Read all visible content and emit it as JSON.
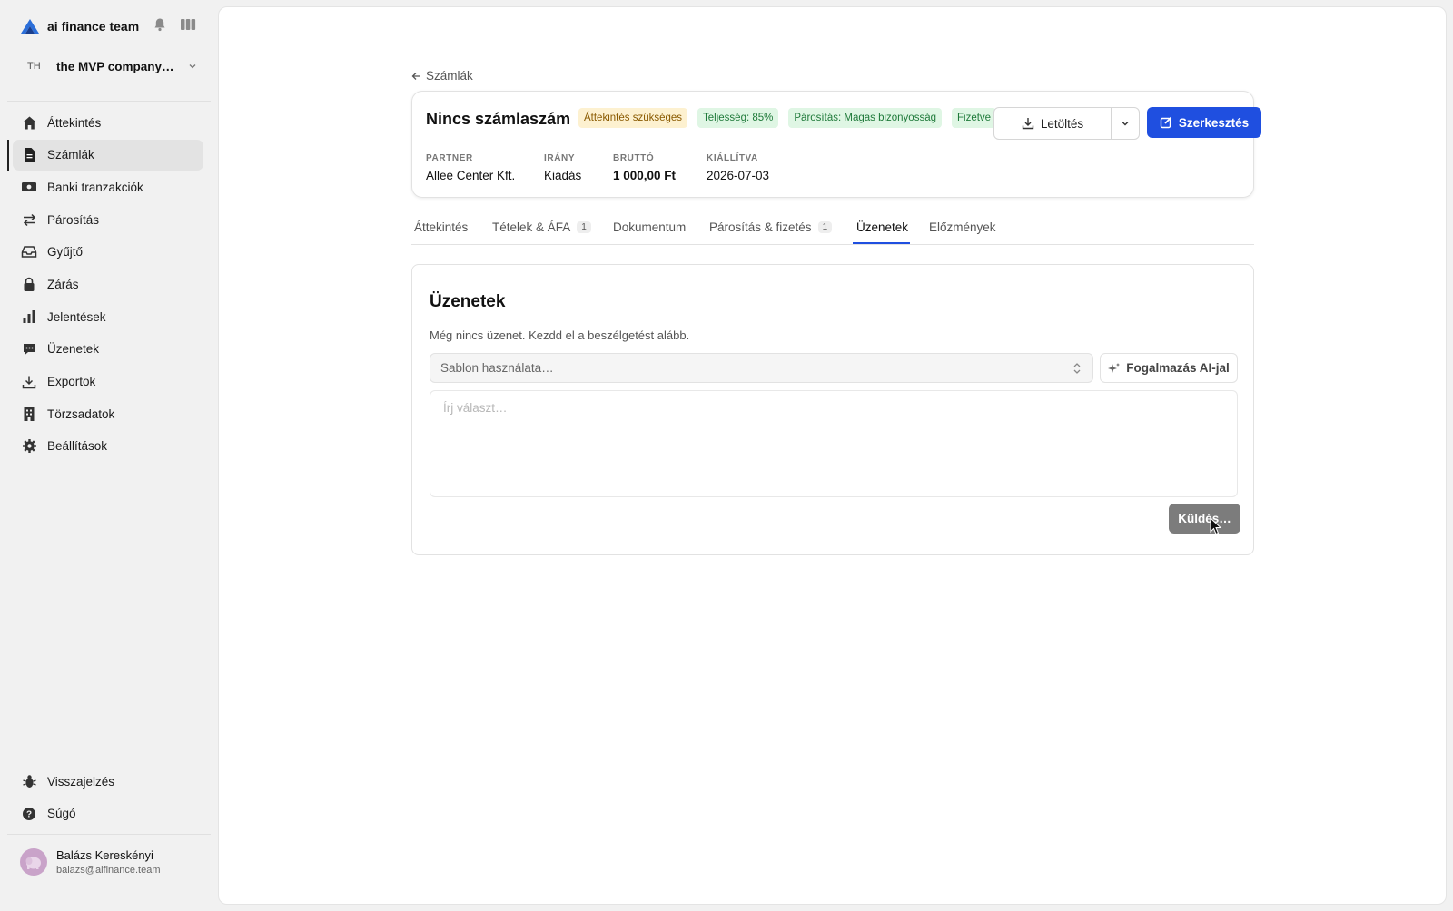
{
  "sidebar": {
    "brand": "ai finance team",
    "company": {
      "initials": "TH",
      "name": "the MVP company…"
    },
    "items": [
      {
        "label": "Áttekintés",
        "icon": "home-icon"
      },
      {
        "label": "Számlák",
        "icon": "document-icon",
        "active": true
      },
      {
        "label": "Banki tranzakciók",
        "icon": "banknote-icon"
      },
      {
        "label": "Párosítás",
        "icon": "swap-icon"
      },
      {
        "label": "Gyűjtő",
        "icon": "inbox-icon"
      },
      {
        "label": "Zárás",
        "icon": "lock-icon"
      },
      {
        "label": "Jelentések",
        "icon": "bar-chart-icon"
      },
      {
        "label": "Üzenetek",
        "icon": "chat-icon"
      },
      {
        "label": "Exportok",
        "icon": "download-icon"
      },
      {
        "label": "Törzsadatok",
        "icon": "building-icon"
      },
      {
        "label": "Beállítások",
        "icon": "gear-icon"
      }
    ],
    "bottom_items": [
      {
        "label": "Visszajelzés",
        "icon": "bug-icon"
      },
      {
        "label": "Súgó",
        "icon": "help-icon"
      }
    ],
    "user": {
      "name": "Balázs Kereskényi",
      "email": "balazs@aifinance.team"
    }
  },
  "invoice": {
    "back_label": "Számlák",
    "title": "Nincs számlaszám",
    "badges": [
      {
        "label": "Áttekintés szükséges",
        "kind": "warn"
      },
      {
        "label": "Teljesség: 85%",
        "kind": "ok"
      },
      {
        "label": "Párosítás: Magas bizonyosság",
        "kind": "ok"
      },
      {
        "label": "Fizetve",
        "kind": "ok"
      }
    ],
    "download_label": "Letöltés",
    "edit_label": "Szerkesztés",
    "meta": [
      {
        "label": "PARTNER",
        "value": "Allee Center Kft."
      },
      {
        "label": "IRÁNY",
        "value": "Kiadás"
      },
      {
        "label": "BRUTTÓ",
        "value": "1 000,00 Ft"
      },
      {
        "label": "KIÁLLÍTVA",
        "value": "2026-07-03"
      }
    ]
  },
  "tabs": [
    {
      "label": "Áttekintés"
    },
    {
      "label": "Tételek & ÁFA",
      "count": "1"
    },
    {
      "label": "Dokumentum"
    },
    {
      "label": "Párosítás & fizetés",
      "count": "1"
    },
    {
      "label": "Üzenetek",
      "active": true
    },
    {
      "label": "Előzmények"
    }
  ],
  "messages": {
    "title": "Üzenetek",
    "empty_text": "Még nincs üzenet. Kezdd el a beszélgetést alább.",
    "template_placeholder": "Sablon használata…",
    "ai_button": "Fogalmazás AI-jal",
    "reply_placeholder": "Írj választ…",
    "send_label": "Küldés…"
  },
  "colors": {
    "accent": "#1f4fe0",
    "warn_bg": "#fdf1d0",
    "ok_bg": "#dff6e4"
  }
}
